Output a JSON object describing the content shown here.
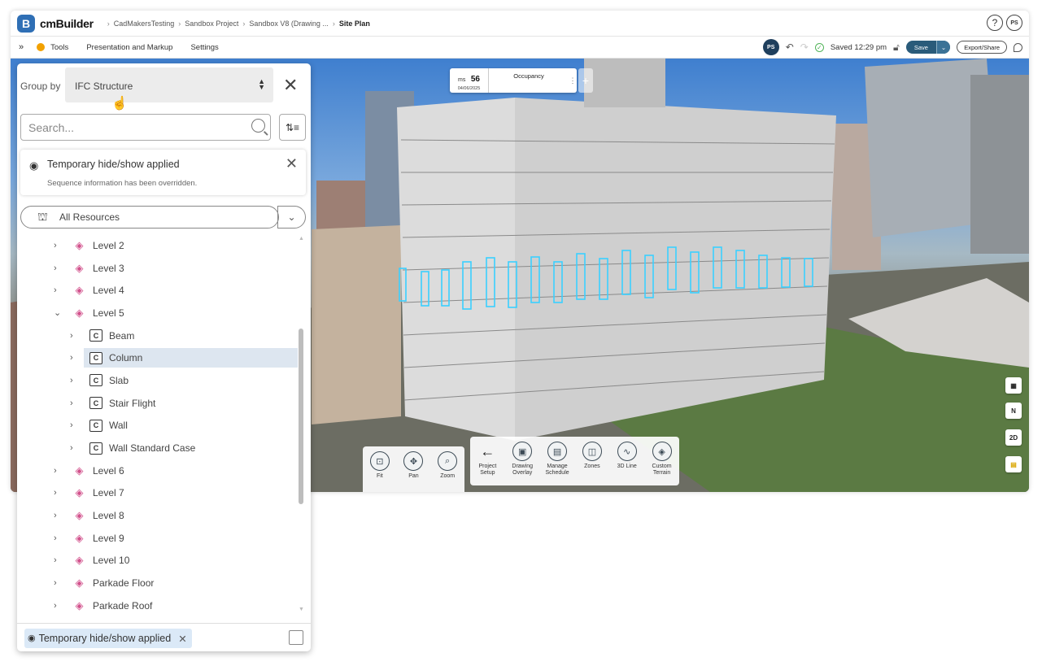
{
  "header": {
    "logo_letter": "B",
    "brand": "cmBuilder",
    "breadcrumbs": [
      "CadMakersTesting",
      "Sandbox Project",
      "Sandbox V8 (Drawing ...",
      "Site Plan"
    ],
    "help_label": "?",
    "user_initials": "PS"
  },
  "toolbar": {
    "expand_label": "»",
    "tools_label": "Tools",
    "presentation_label": "Presentation and Markup",
    "settings_label": "Settings",
    "user_initials": "PS",
    "saved_label": "Saved 12:29 pm",
    "save_label": "Save",
    "export_label": "Export/Share"
  },
  "timeline": {
    "ms_prefix": "ms",
    "ms_number": "56",
    "date": "04/06/2025",
    "phase": "Occupancy",
    "add_label": "+"
  },
  "viewport_side": {
    "north_label": "N",
    "view_2d_label": "2D"
  },
  "viewport_tools": {
    "nav": [
      {
        "label": "Fit",
        "icon": "fit-icon"
      },
      {
        "label": "Pan",
        "icon": "pan-icon"
      },
      {
        "label": "Zoom",
        "icon": "zoom-icon"
      }
    ],
    "actions": [
      {
        "label": "Project Setup",
        "icon": "back-arrow-icon"
      },
      {
        "label": "Drawing Overlay",
        "icon": "drawing-overlay-icon"
      },
      {
        "label": "Manage Schedule",
        "icon": "schedule-icon"
      },
      {
        "label": "Zones",
        "icon": "zones-icon"
      },
      {
        "label": "3D Line",
        "icon": "3d-line-icon"
      },
      {
        "label": "Custom Terrain",
        "icon": "terrain-icon"
      }
    ]
  },
  "panel": {
    "group_by_label": "Group by",
    "group_by_value": "IFC Structure",
    "search_placeholder": "Search...",
    "notice_title": "Temporary hide/show applied",
    "notice_subtitle": "Sequence information has been overridden.",
    "resource_filter": "All Resources",
    "tree": [
      {
        "label": "Level 2",
        "type": "level",
        "depth": 0,
        "expanded": false
      },
      {
        "label": "Level 3",
        "type": "level",
        "depth": 0,
        "expanded": false
      },
      {
        "label": "Level 4",
        "type": "level",
        "depth": 0,
        "expanded": false
      },
      {
        "label": "Level 5",
        "type": "level",
        "depth": 0,
        "expanded": true
      },
      {
        "label": "Beam",
        "type": "class",
        "depth": 1,
        "expanded": false
      },
      {
        "label": "Column",
        "type": "class",
        "depth": 1,
        "expanded": false,
        "selected": true
      },
      {
        "label": "Slab",
        "type": "class",
        "depth": 1,
        "expanded": false
      },
      {
        "label": "Stair Flight",
        "type": "class",
        "depth": 1,
        "expanded": false
      },
      {
        "label": "Wall",
        "type": "class",
        "depth": 1,
        "expanded": false
      },
      {
        "label": "Wall Standard Case",
        "type": "class",
        "depth": 1,
        "expanded": false
      },
      {
        "label": "Level 6",
        "type": "level",
        "depth": 0,
        "expanded": false
      },
      {
        "label": "Level 7",
        "type": "level",
        "depth": 0,
        "expanded": false
      },
      {
        "label": "Level 8",
        "type": "level",
        "depth": 0,
        "expanded": false
      },
      {
        "label": "Level 9",
        "type": "level",
        "depth": 0,
        "expanded": false
      },
      {
        "label": "Level 10",
        "type": "level",
        "depth": 0,
        "expanded": false
      },
      {
        "label": "Parkade Floor",
        "type": "level",
        "depth": 0,
        "expanded": false
      },
      {
        "label": "Parkade Roof",
        "type": "level",
        "depth": 0,
        "expanded": false
      }
    ],
    "class_icon_letter": "C",
    "footer_chip": "Temporary hide/show applied"
  },
  "colors": {
    "brand_blue": "#2f6fb5",
    "save_button": "#2a5b7a",
    "level_icon": "#d2518c",
    "selection_outline": "#3ad0ff",
    "selected_row": "#dde6f0"
  }
}
